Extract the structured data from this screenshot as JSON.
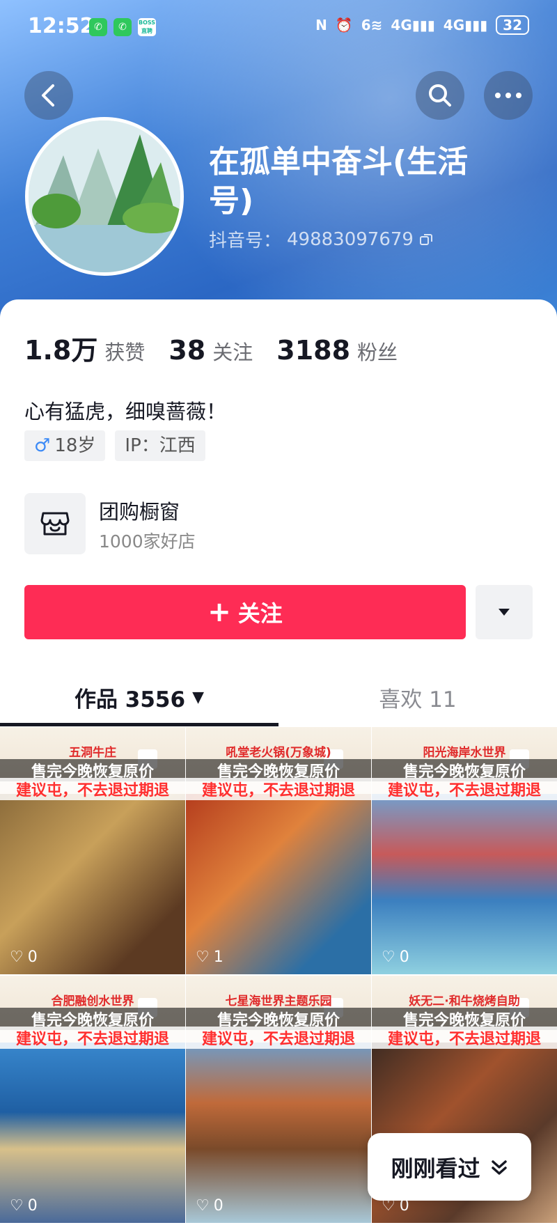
{
  "status_bar": {
    "time": "12:52",
    "app_icons": [
      "wechat-icon",
      "wechat-icon",
      "boss-zhipin-icon"
    ],
    "boss_label": "BOSS直聘",
    "signal_labels": [
      "6",
      "4G",
      "4G"
    ],
    "battery": "32"
  },
  "profile": {
    "name": "在孤单中奋斗(生活号)",
    "douyin_id_label": "抖音号：",
    "douyin_id": "49883097679",
    "likes_count": "1.8万",
    "likes_label": "获赞",
    "following_count": "38",
    "following_label": "关注",
    "followers_count": "3188",
    "followers_label": "粉丝",
    "bio": "心有猛虎，细嗅蔷薇！",
    "tags": {
      "gender_symbol": "♂",
      "age": "18岁",
      "ip": "IP：江西"
    }
  },
  "shop": {
    "title": "团购橱窗",
    "subtitle": "1000家好店"
  },
  "actions": {
    "follow_plus": "+",
    "follow_label": "关注"
  },
  "tabs": {
    "works_label": "作品 3556",
    "likes_label": "喜欢 11"
  },
  "videos": [
    {
      "shop": "五洞牛庄",
      "line1": "售完今晚恢复原价",
      "line2": "建议屯，不去退过期退",
      "likes": "0"
    },
    {
      "shop": "吼堂老火锅(万象城)",
      "line1": "售完今晚恢复原价",
      "line2": "建议屯，不去退过期退",
      "likes": "1"
    },
    {
      "shop": "阳光海岸水世界",
      "line1": "售完今晚恢复原价",
      "line2": "建议屯，不去退过期退",
      "likes": "0"
    },
    {
      "shop": "合肥融创水世界",
      "line1": "售完今晚恢复原价",
      "line2": "建议屯，不去退过期退",
      "likes": "0"
    },
    {
      "shop": "七星海世界主题乐园",
      "line1": "售完今晚恢复原价",
      "line2": "建议屯，不去退过期退",
      "likes": "0"
    },
    {
      "shop": "妖无二·和牛烧烤自助",
      "line1": "售完今晚恢复原价",
      "line2": "建议屯，不去退过期退",
      "likes": "0"
    }
  ],
  "recent_button": {
    "label": "刚刚看过"
  },
  "colors": {
    "accent": "#fe2c55",
    "text_primary": "#161823",
    "header_blue": "#2b67c4"
  }
}
